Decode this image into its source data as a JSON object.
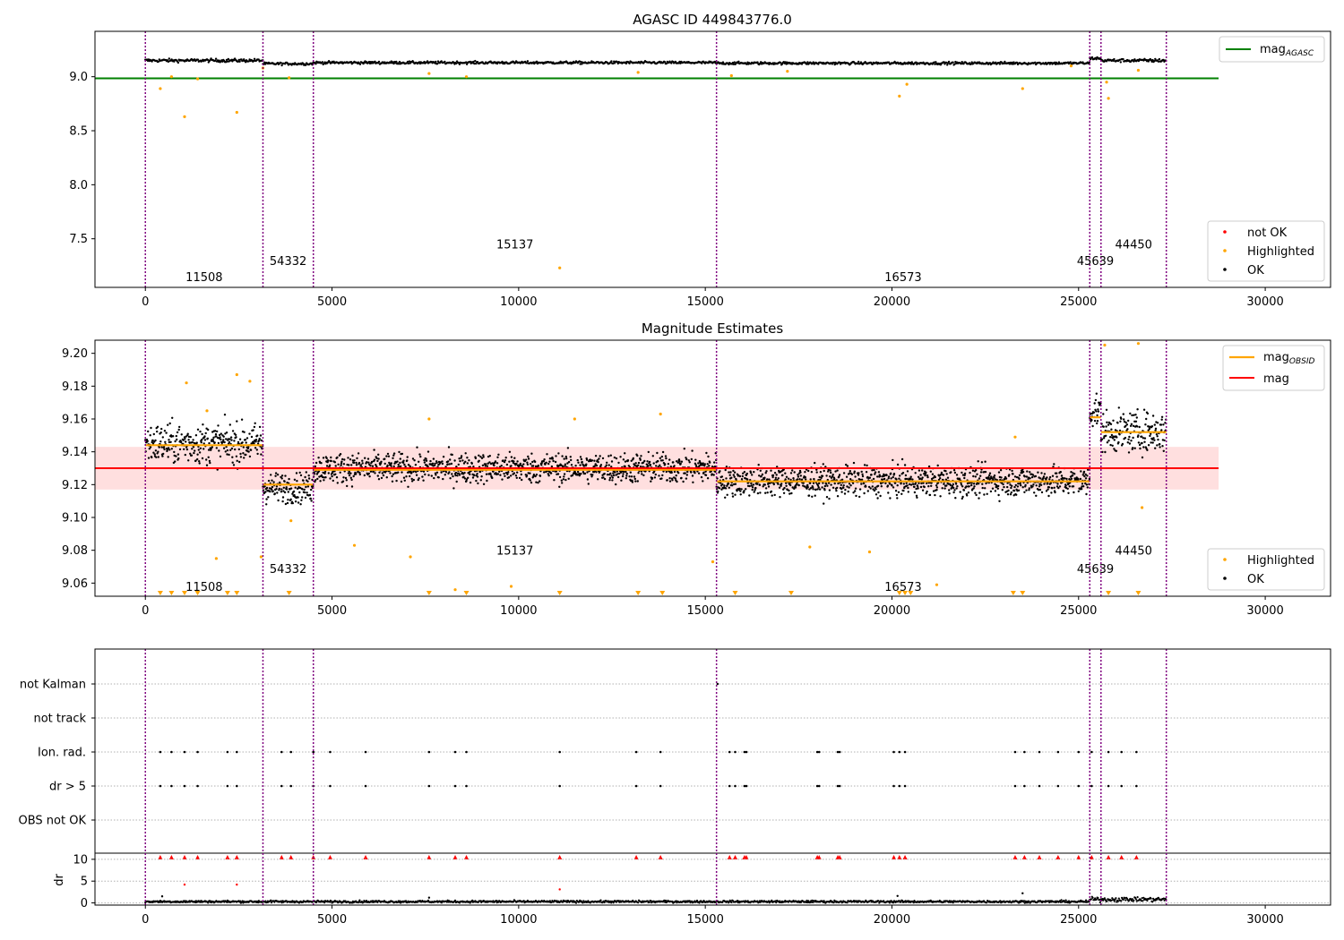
{
  "figure": {
    "background": "#ffffff"
  },
  "colors": {
    "agasc": "#008000",
    "ok": "#000000",
    "highlighted": "#ffa500",
    "not_ok": "#ff0000",
    "obsid_mag": "#ffa500",
    "mag": "#ff0000",
    "band": "#ffc0c0",
    "obs_line": "#800080",
    "hline": "#000000",
    "grid": "#b0b0b0"
  },
  "chart_data": [
    {
      "type": "scatter",
      "title": "AGASC ID 449843776.0",
      "xlim": [
        -1350,
        31750
      ],
      "ylim": [
        7.05,
        9.42
      ],
      "xticks": [
        0,
        5000,
        10000,
        15000,
        20000,
        25000,
        30000
      ],
      "yticks": [
        9.0,
        8.5,
        8.0,
        7.5
      ],
      "ytick_labels": [
        "9.0",
        "8.5",
        "8.0",
        "7.5"
      ],
      "obs_boundaries": [
        0,
        3150,
        4500,
        15300,
        25300,
        25600,
        27350
      ],
      "obsids": [
        {
          "label": "11508",
          "x": 1575,
          "y": 7.15
        },
        {
          "label": "54332",
          "x": 3825,
          "y": 7.3
        },
        {
          "label": "15137",
          "x": 9900,
          "y": 7.45
        },
        {
          "label": "16573",
          "x": 20300,
          "y": 7.15
        },
        {
          "label": "45639",
          "x": 25450,
          "y": 7.3
        },
        {
          "label": "44450",
          "x": 26475,
          "y": 7.45
        }
      ],
      "agasc_mag": 8.985,
      "agasc_xrange": [
        -1350,
        28750
      ],
      "segments": [
        {
          "x0": 0,
          "x1": 3150,
          "level": 9.15,
          "spread": 0.015
        },
        {
          "x0": 3150,
          "x1": 4500,
          "level": 9.12,
          "spread": 0.012
        },
        {
          "x0": 4500,
          "x1": 15300,
          "level": 9.13,
          "spread": 0.012
        },
        {
          "x0": 15300,
          "x1": 25300,
          "level": 9.125,
          "spread": 0.012
        },
        {
          "x0": 25300,
          "x1": 25600,
          "level": 9.17,
          "spread": 0.012
        },
        {
          "x0": 25600,
          "x1": 27350,
          "level": 9.15,
          "spread": 0.015
        }
      ],
      "highlighted_points": [
        [
          400,
          8.89
        ],
        [
          700,
          9.0
        ],
        [
          1050,
          8.63
        ],
        [
          1400,
          8.98
        ],
        [
          2450,
          8.67
        ],
        [
          3150,
          9.08
        ],
        [
          3850,
          8.99
        ],
        [
          7600,
          9.03
        ],
        [
          8600,
          9.0
        ],
        [
          11100,
          7.23
        ],
        [
          13200,
          9.04
        ],
        [
          15700,
          9.01
        ],
        [
          17200,
          9.05
        ],
        [
          20200,
          8.82
        ],
        [
          20400,
          8.93
        ],
        [
          23500,
          8.89
        ],
        [
          24800,
          9.1
        ],
        [
          25750,
          8.95
        ],
        [
          25800,
          8.8
        ],
        [
          26600,
          9.06
        ]
      ],
      "legend_lines": [
        {
          "label": "mag",
          "sub": "AGASC"
        }
      ],
      "legend_markers": [
        "not OK",
        "Highlighted",
        "OK"
      ]
    },
    {
      "type": "scatter",
      "title": "Magnitude Estimates",
      "xlim": [
        -1350,
        31750
      ],
      "ylim": [
        9.052,
        9.208
      ],
      "xticks": [
        0,
        5000,
        10000,
        15000,
        20000,
        25000,
        30000
      ],
      "yticks": [
        9.2,
        9.18,
        9.16,
        9.14,
        9.12,
        9.1,
        9.08,
        9.06
      ],
      "ytick_labels": [
        "9.20",
        "9.18",
        "9.16",
        "9.14",
        "9.12",
        "9.10",
        "9.08",
        "9.06"
      ],
      "obs_boundaries": [
        0,
        3150,
        4500,
        15300,
        25300,
        25600,
        27350
      ],
      "obsids": [
        {
          "label": "11508",
          "x": 1575,
          "y": 9.058
        },
        {
          "label": "54332",
          "x": 3825,
          "y": 9.069
        },
        {
          "label": "15137",
          "x": 9900,
          "y": 9.08
        },
        {
          "label": "16573",
          "x": 20300,
          "y": 9.058
        },
        {
          "label": "45639",
          "x": 25450,
          "y": 9.069
        },
        {
          "label": "44450",
          "x": 26475,
          "y": 9.08
        }
      ],
      "mag": 9.13,
      "mag_band": [
        9.117,
        9.143
      ],
      "mag_xrange": [
        -1350,
        28750
      ],
      "obsid_mags": [
        {
          "x0": 0,
          "x1": 3150,
          "value": 9.144
        },
        {
          "x0": 3150,
          "x1": 4500,
          "value": 9.12
        },
        {
          "x0": 4500,
          "x1": 15300,
          "value": 9.129
        },
        {
          "x0": 15300,
          "x1": 25300,
          "value": 9.122
        },
        {
          "x0": 25300,
          "x1": 25600,
          "value": 9.161
        },
        {
          "x0": 25600,
          "x1": 27350,
          "value": 9.152
        }
      ],
      "segments": [
        {
          "x0": 0,
          "x1": 3150,
          "level": 9.145,
          "spread": 0.012
        },
        {
          "x0": 3150,
          "x1": 4500,
          "level": 9.118,
          "spread": 0.009
        },
        {
          "x0": 4500,
          "x1": 15300,
          "level": 9.13,
          "spread": 0.009
        },
        {
          "x0": 15300,
          "x1": 25300,
          "level": 9.122,
          "spread": 0.009
        },
        {
          "x0": 25300,
          "x1": 25600,
          "level": 9.165,
          "spread": 0.011
        },
        {
          "x0": 25600,
          "x1": 27350,
          "level": 9.152,
          "spread": 0.012
        }
      ],
      "highlighted_points": [
        [
          1100,
          9.182
        ],
        [
          1650,
          9.165
        ],
        [
          1900,
          9.075
        ],
        [
          2450,
          9.187
        ],
        [
          2800,
          9.183
        ],
        [
          3100,
          9.076
        ],
        [
          3900,
          9.098
        ],
        [
          5600,
          9.083
        ],
        [
          7100,
          9.076
        ],
        [
          7600,
          9.16
        ],
        [
          8300,
          9.056
        ],
        [
          9800,
          9.058
        ],
        [
          11500,
          9.16
        ],
        [
          13800,
          9.163
        ],
        [
          15200,
          9.073
        ],
        [
          17800,
          9.082
        ],
        [
          19400,
          9.079
        ],
        [
          21200,
          9.059
        ],
        [
          23300,
          9.149
        ],
        [
          25700,
          9.205
        ],
        [
          26600,
          9.206
        ],
        [
          26700,
          9.106
        ]
      ],
      "clipped_x": [
        400,
        700,
        1050,
        1400,
        2200,
        2450,
        3850,
        7600,
        8600,
        11100,
        13200,
        13850,
        15800,
        17300,
        20200,
        20350,
        20500,
        23250,
        23500,
        25800,
        26600
      ],
      "legend_lines": [
        {
          "label": "mag",
          "sub": "OBSID"
        },
        {
          "label": "mag",
          "sub": ""
        }
      ],
      "legend_markers": [
        "Highlighted",
        "OK"
      ]
    },
    {
      "type": "scatter",
      "xlim": [
        -1350,
        31750
      ],
      "xticks": [
        0,
        5000,
        10000,
        15000,
        20000,
        25000,
        30000
      ],
      "obs_boundaries": [
        0,
        3150,
        4500,
        15300,
        25300,
        25600,
        27350
      ],
      "flag_labels": [
        "not Kalman",
        "not track",
        "Ion. rad.",
        "dr > 5",
        "OBS not OK"
      ],
      "flag_events": [
        400,
        700,
        1050,
        1400,
        2200,
        2450,
        3650,
        3900,
        4500,
        4950,
        5900,
        7600,
        8300,
        8600,
        11100,
        13150,
        13800,
        15650,
        15800,
        16050,
        16100,
        18000,
        18050,
        18550,
        18600,
        20050,
        20200,
        20350,
        23300,
        23550,
        23950,
        24450,
        25000,
        25350,
        25800,
        26150,
        26550
      ],
      "not_kalman_x": [
        15330
      ],
      "dr_ylabel": "dr",
      "dr_yticks": [
        10,
        5,
        0
      ],
      "dr_ylim": [
        -0.5,
        11
      ],
      "dr_spikes": [
        [
          450,
          1.5
        ],
        [
          1050,
          4.2
        ],
        [
          2450,
          4.2
        ],
        [
          7600,
          1.2
        ],
        [
          11100,
          3.1
        ],
        [
          20150,
          1.6
        ],
        [
          23500,
          2.2
        ]
      ],
      "dr_segments": [
        {
          "x0": 0,
          "x1": 25300,
          "level": 0.3,
          "spread": 0.25
        },
        {
          "x0": 25300,
          "x1": 27350,
          "level": 0.8,
          "spread": 0.5
        }
      ]
    }
  ]
}
